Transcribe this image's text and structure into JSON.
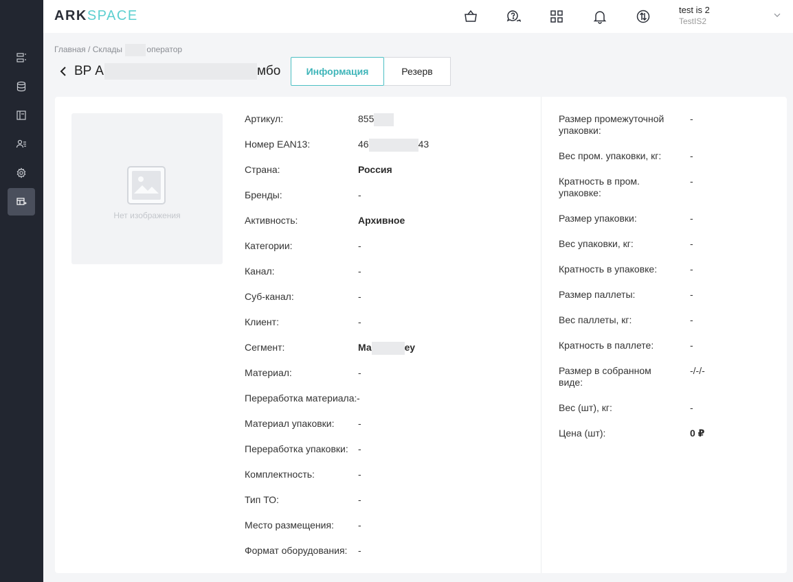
{
  "app": {
    "logo_ark": "ARK",
    "logo_space": "SPACE"
  },
  "user": {
    "name": "test is 2",
    "org": "TestIS2"
  },
  "breadcrumb": {
    "home": "Главная",
    "sep": " / ",
    "warehouses": "Склады",
    "operator": "оператор"
  },
  "page": {
    "title_start": "BP А",
    "title_end": "мбо"
  },
  "tabs": [
    {
      "label": "Информация",
      "active": true
    },
    {
      "label": "Резерв",
      "active": false
    }
  ],
  "image_placeholder": {
    "text": "Нет изображения"
  },
  "left_fields": [
    {
      "label": "Артикул:",
      "value": "855",
      "bold": false,
      "redacted": true
    },
    {
      "label": "Номер EAN13:",
      "value": "46",
      "value_tail": "43",
      "bold": false,
      "redacted": true
    },
    {
      "label": "Страна:",
      "value": "Россия",
      "bold": true
    },
    {
      "label": "Бренды:",
      "value": "-"
    },
    {
      "label": "Активность:",
      "value": "Архивное",
      "bold": true
    },
    {
      "label": "Категории:",
      "value": "-"
    },
    {
      "label": "Канал:",
      "value": "-"
    },
    {
      "label": "Суб-канал:",
      "value": "-"
    },
    {
      "label": "Клиент:",
      "value": "-"
    },
    {
      "label": "Сегмент:",
      "value": "Ма",
      "value_tail": "еу",
      "bold": true,
      "redacted": true
    },
    {
      "label": "Материал:",
      "value": "-"
    },
    {
      "label": "Переработка материала:",
      "value": "-"
    },
    {
      "label": "Материал упаковки:",
      "value": "-"
    },
    {
      "label": "Переработка упаковки:",
      "value": "-"
    },
    {
      "label": "Комплектность:",
      "value": "-"
    },
    {
      "label": "Тип ТО:",
      "value": "-"
    },
    {
      "label": "Место размещения:",
      "value": "-"
    },
    {
      "label": "Формат оборудования:",
      "value": "-"
    }
  ],
  "right_fields": [
    {
      "label": "Размер промежуточной",
      "label2": "упаковки:",
      "value": "-"
    },
    {
      "label": "Вес пром. упаковки, кг:",
      "value": "-"
    },
    {
      "label": "Кратность в пром.",
      "label2": "упаковке:",
      "value": "-"
    },
    {
      "label": "Размер упаковки:",
      "value": "-"
    },
    {
      "label": "Вес упаковки, кг:",
      "value": "-"
    },
    {
      "label": "Кратность в упаковке:",
      "value": "-"
    },
    {
      "label": "Размер паллеты:",
      "value": "-"
    },
    {
      "label": "Вес паллеты, кг:",
      "value": "-"
    },
    {
      "label": "Кратность в паллете:",
      "value": "-"
    },
    {
      "label": "Размер в собранном",
      "label2": "виде:",
      "value": "-/-/-"
    },
    {
      "label": "Вес (шт), кг:",
      "value": "-"
    },
    {
      "label": "Цена (шт):",
      "value": "0 ₽",
      "bold": true
    }
  ]
}
